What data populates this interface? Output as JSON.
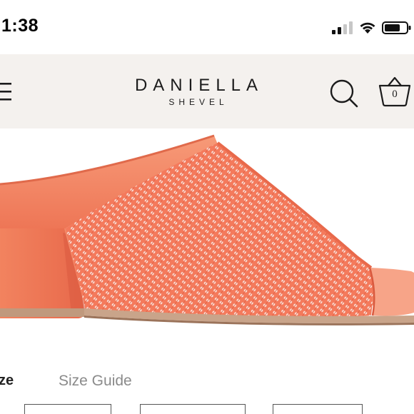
{
  "status_bar": {
    "time": "1:38",
    "signal_icon": "cellular-signal-icon",
    "wifi_icon": "wifi-icon",
    "battery_icon": "battery-icon"
  },
  "header": {
    "menu_icon": "hamburger-menu-icon",
    "brand_main": "DANIELLA",
    "brand_sub": "SHEVEL",
    "search_icon": "search-icon",
    "cart_icon": "shopping-basket-icon",
    "cart_count": "0",
    "background_color": "#f4f1ee"
  },
  "product": {
    "image_subject": "coral woven leather open-toe block-heel mule",
    "accent_color": "#f07a5a"
  },
  "size_selector": {
    "label": "ze",
    "guide_link": "Size Guide"
  }
}
